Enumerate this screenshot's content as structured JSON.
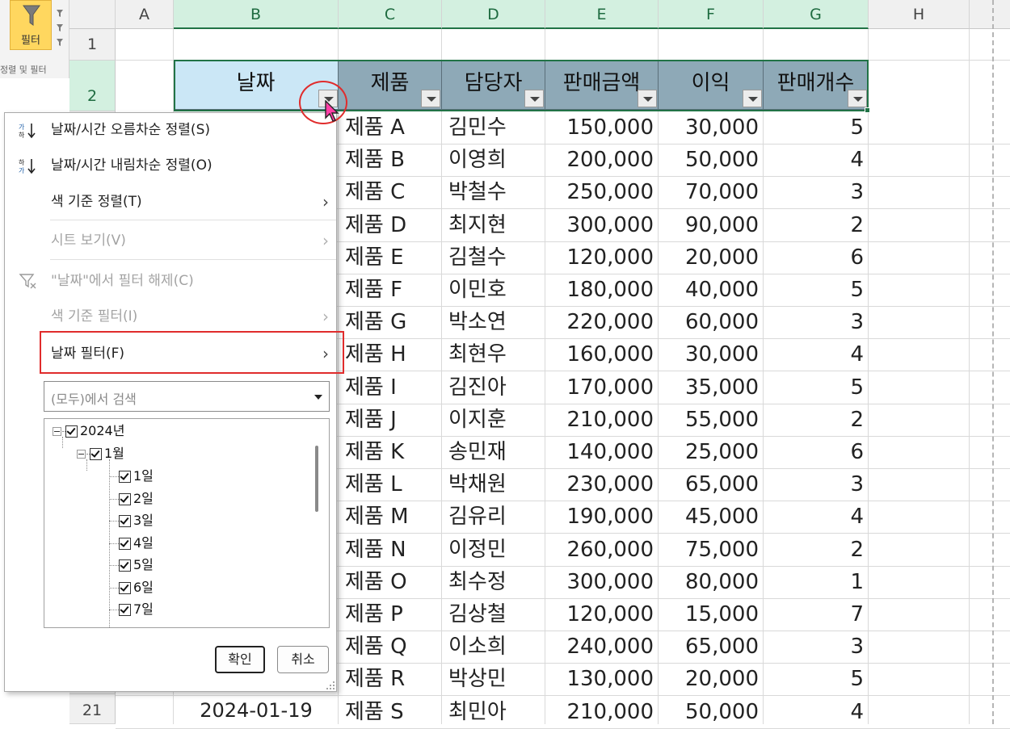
{
  "ribbon": {
    "filter_label": "필터",
    "group_caption": "정렬 및 필터"
  },
  "columns": [
    "A",
    "B",
    "C",
    "D",
    "E",
    "F",
    "G",
    "H"
  ],
  "rows": [
    "1",
    "2",
    "21"
  ],
  "table": {
    "headers": [
      "날짜",
      "제품",
      "담당자",
      "판매금액",
      "이익",
      "판매개수"
    ],
    "data_rows": [
      [
        "제품 A",
        "김민수",
        "150,000",
        "30,000",
        "5"
      ],
      [
        "제품 B",
        "이영희",
        "200,000",
        "50,000",
        "4"
      ],
      [
        "제품 C",
        "박철수",
        "250,000",
        "70,000",
        "3"
      ],
      [
        "제품 D",
        "최지현",
        "300,000",
        "90,000",
        "2"
      ],
      [
        "제품 E",
        "김철수",
        "120,000",
        "20,000",
        "6"
      ],
      [
        "제품 F",
        "이민호",
        "180,000",
        "40,000",
        "5"
      ],
      [
        "제품 G",
        "박소연",
        "220,000",
        "60,000",
        "3"
      ],
      [
        "제품 H",
        "최현우",
        "160,000",
        "30,000",
        "4"
      ],
      [
        "제품 I",
        "김진아",
        "170,000",
        "35,000",
        "5"
      ],
      [
        "제품 J",
        "이지훈",
        "210,000",
        "55,000",
        "2"
      ],
      [
        "제품 K",
        "송민재",
        "140,000",
        "25,000",
        "6"
      ],
      [
        "제품 L",
        "박채원",
        "230,000",
        "65,000",
        "3"
      ],
      [
        "제품 M",
        "김유리",
        "190,000",
        "45,000",
        "4"
      ],
      [
        "제품 N",
        "이정민",
        "260,000",
        "75,000",
        "2"
      ],
      [
        "제품 O",
        "최수정",
        "300,000",
        "80,000",
        "1"
      ],
      [
        "제품 P",
        "김상철",
        "120,000",
        "15,000",
        "7"
      ],
      [
        "제품 Q",
        "이소희",
        "240,000",
        "65,000",
        "3"
      ],
      [
        "제품 R",
        "박상민",
        "130,000",
        "20,000",
        "5"
      ],
      [
        "제품 S",
        "최민아",
        "210,000",
        "50,000",
        "4"
      ]
    ],
    "last_row_date": "2024-01-19"
  },
  "menu": {
    "sort_asc": "날짜/시간 오름차순 정렬(S)",
    "sort_desc": "날짜/시간 내림차순 정렬(O)",
    "sort_by_color": "색 기준 정렬(T)",
    "sheet_view": "시트 보기(V)",
    "clear_filter": "\"날짜\"에서 필터 해제(C)",
    "filter_by_color": "색 기준 필터(I)",
    "date_filter": "날짜 필터(F)",
    "search_placeholder": "(모두)에서 검색",
    "tree": {
      "year": "2024년",
      "month": "1월",
      "days": [
        "1일",
        "2일",
        "3일",
        "4일",
        "5일",
        "6일",
        "7일"
      ]
    },
    "ok_label": "확인",
    "cancel_label": "취소"
  },
  "colors": {
    "header_fill": "#8ea9b7",
    "date_header_fill": "#cbe7f6",
    "highlight_red": "#e02c2c",
    "selection_green": "#217346",
    "filter_button": "#ffd75f"
  }
}
